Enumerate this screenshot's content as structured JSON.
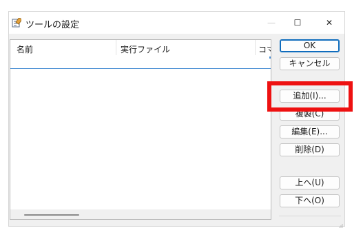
{
  "window": {
    "title": "ツールの設定",
    "icon": "tools-settings-icon",
    "minimize_glyph": "—",
    "maximize_glyph": "☐",
    "close_glyph": "✕"
  },
  "list": {
    "columns": [
      "名前",
      "実行ファイル",
      "コマ"
    ]
  },
  "buttons": {
    "ok": "OK",
    "cancel": "キャンセル",
    "add": "追加(I)...",
    "copy": "複製(C)",
    "edit": "編集(E)...",
    "delete": "削除(D)",
    "up": "上へ(U)",
    "down": "下へ(O)"
  },
  "colors": {
    "highlight": "#ee1111",
    "accent": "#0f6cbd"
  }
}
